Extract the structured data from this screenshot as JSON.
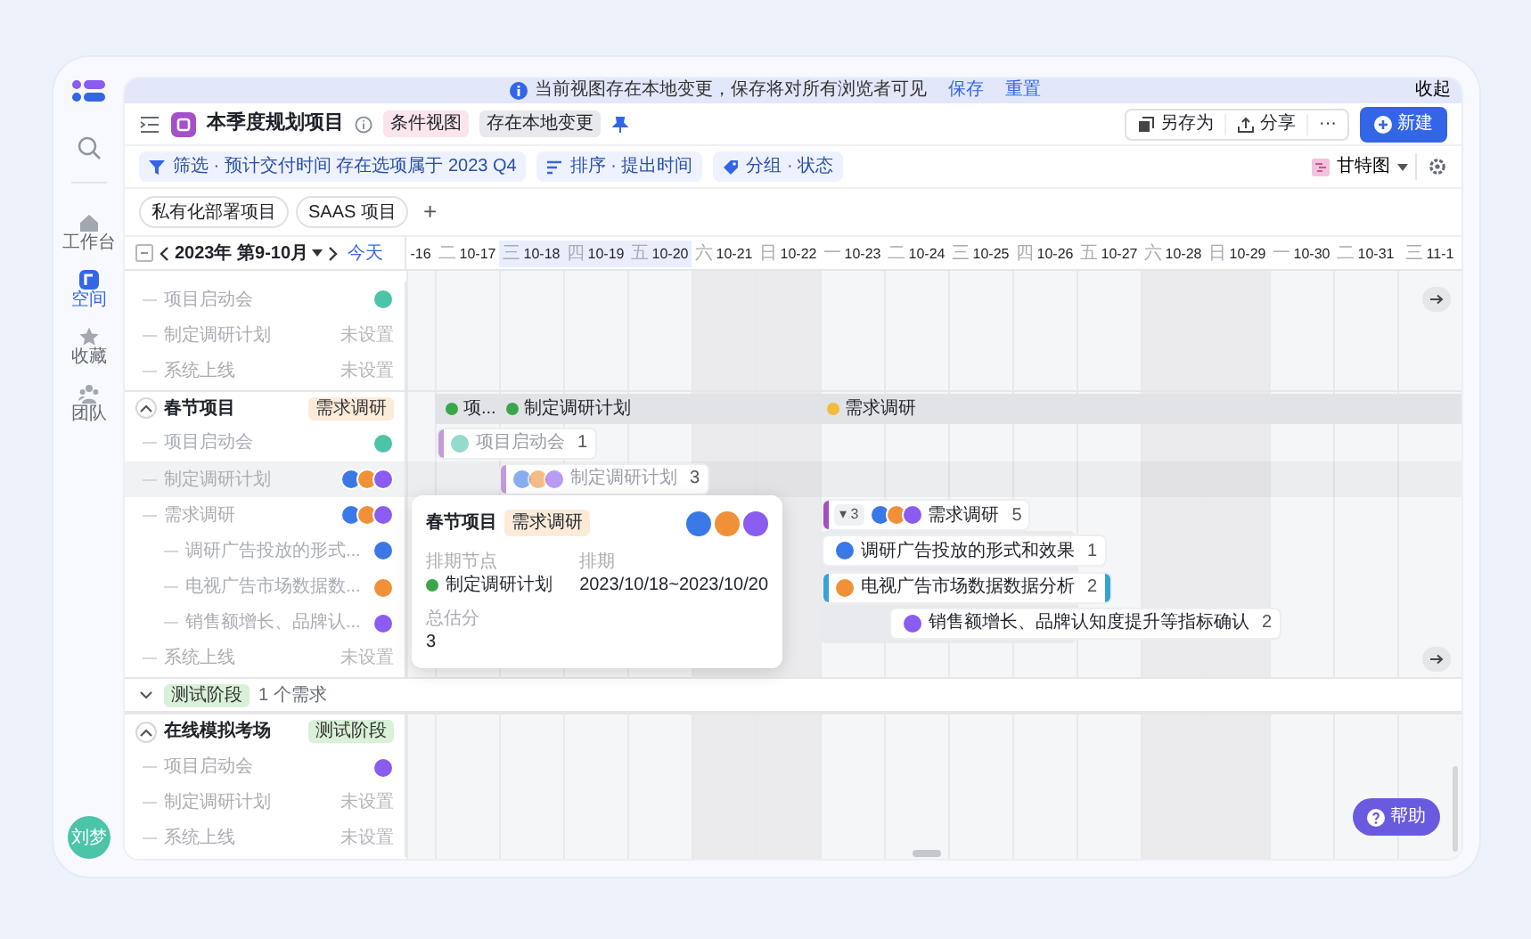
{
  "sidebar": {
    "items": [
      {
        "label": "工作台",
        "selected": false
      },
      {
        "label": "空间",
        "selected": true
      },
      {
        "label": "收藏",
        "selected": false
      },
      {
        "label": "团队",
        "selected": false
      }
    ],
    "user": "刘梦"
  },
  "notice": {
    "text": "当前视图存在本地变更，保存将对所有浏览者可见",
    "links": [
      "保存",
      "重置"
    ],
    "collapse": "收起"
  },
  "header": {
    "title": "本季度规划项目",
    "tags": [
      {
        "label": "条件视图",
        "color": "#fbe4ec"
      },
      {
        "label": "存在本地变更",
        "color": "#e8e9ec"
      }
    ],
    "actions": [
      "另存为",
      "分享",
      "···"
    ],
    "primary": "新建"
  },
  "filters": [
    "筛选 · 预计交付时间 存在选项属于 2023 Q4",
    "排序 · 提出时间",
    "分组 · 状态"
  ],
  "view": {
    "label": "甘特图"
  },
  "tabs": [
    "私有化部署项目",
    "SAAS 项目"
  ],
  "tab_add": "+",
  "gantt_nav": {
    "period": "2023年 第9-10月",
    "today": "今天"
  },
  "days": [
    {
      "date": "-16",
      "weekend": false,
      "highlighted": false
    },
    {
      "weekday": "二",
      "date": "10-17",
      "weekend": false,
      "highlighted": false
    },
    {
      "weekday": "三",
      "date": "10-18",
      "weekend": false,
      "highlighted": true
    },
    {
      "weekday": "四",
      "date": "10-19",
      "weekend": false,
      "highlighted": true
    },
    {
      "weekday": "五",
      "date": "10-20",
      "weekend": false,
      "highlighted": true
    },
    {
      "weekday": "六",
      "date": "10-21",
      "weekend": true,
      "highlighted": false
    },
    {
      "weekday": "日",
      "date": "10-22",
      "weekend": true,
      "highlighted": false
    },
    {
      "weekday": "一",
      "date": "10-23",
      "weekend": false,
      "highlighted": false
    },
    {
      "weekday": "二",
      "date": "10-24",
      "weekend": false,
      "highlighted": false
    },
    {
      "weekday": "三",
      "date": "10-25",
      "weekend": false,
      "highlighted": false
    },
    {
      "weekday": "四",
      "date": "10-26",
      "weekend": false,
      "highlighted": false
    },
    {
      "weekday": "五",
      "date": "10-27",
      "weekend": false,
      "highlighted": false
    },
    {
      "weekday": "六",
      "date": "10-28",
      "weekend": true,
      "highlighted": false
    },
    {
      "weekday": "日",
      "date": "10-29",
      "weekend": true,
      "highlighted": false
    },
    {
      "weekday": "一",
      "date": "10-30",
      "weekend": false,
      "highlighted": false
    },
    {
      "weekday": "二",
      "date": "10-31",
      "weekend": false,
      "highlighted": false
    },
    {
      "weekday": "三",
      "date": "11-1",
      "weekend": false,
      "highlighted": false
    }
  ],
  "rows": [
    {
      "kind": "task",
      "name": "项目启动会",
      "assignees": [
        {
          "color": "#4cc4a8"
        }
      ],
      "selected": false,
      "jump": true
    },
    {
      "kind": "task",
      "name": "制定调研计划",
      "schedule": "未设置",
      "selected": false,
      "jump": false
    },
    {
      "kind": "task",
      "name": "系统上线",
      "schedule": "未设置",
      "selected": false,
      "jump": false
    },
    {
      "kind": "project",
      "name": "春节项目",
      "tag": {
        "label": "需求调研",
        "color": "#fcebd9"
      },
      "expanded": true,
      "milestones": [
        {
          "label": "项...",
          "color": "#3aa64b"
        },
        {
          "label": "制定调研计划",
          "color": "#3aa64b"
        },
        {
          "label": "需求调研",
          "color": "#f2bb3b"
        }
      ],
      "children": [
        {
          "kind": "task",
          "name": "项目启动会",
          "assignees": [
            {
              "color": "#4cc4a8"
            }
          ],
          "selected": false,
          "jump": false,
          "bar": {
            "label": "项目启动会",
            "count": "1",
            "color": "#c59ad8",
            "faded": true
          }
        },
        {
          "kind": "task",
          "name": "制定调研计划",
          "assignees": [
            {
              "color": "#3b78e7"
            },
            {
              "color": "#f0913a"
            },
            {
              "color": "#8a5cf0"
            }
          ],
          "selected": true,
          "jump": false,
          "bar": {
            "label": "制定调研计划",
            "count": "3",
            "color": "#c59ad8",
            "faded": true
          }
        },
        {
          "kind": "task",
          "name": "需求调研",
          "assignees": [
            {
              "color": "#3b78e7"
            },
            {
              "color": "#f0913a"
            },
            {
              "color": "#8a5cf0"
            }
          ],
          "selected": false,
          "jump": false,
          "bar": {
            "label": "需求调研",
            "count": "5",
            "color": "#a24fc2",
            "faded": false,
            "collapse": "▾ 3"
          },
          "children": [
            {
              "kind": "task",
              "name": "调研广告投放的形式...",
              "assignees": [
                {
                  "color": "#3b78e7"
                }
              ],
              "selected": false,
              "jump": false,
              "bar": {
                "label": "调研广告投放的形式和效果",
                "count": "1",
                "faded": false,
                "selected": false
              }
            },
            {
              "kind": "task",
              "name": "电视广告市场数据数...",
              "assignees": [
                {
                  "color": "#f0913a"
                }
              ],
              "selected": false,
              "jump": false,
              "bar": {
                "label": "电视广告市场数据数据分析",
                "count": "2",
                "faded": false,
                "selected": true
              }
            },
            {
              "kind": "task",
              "name": "销售额增长、品牌认...",
              "assignees": [
                {
                  "color": "#8a5cf0"
                }
              ],
              "selected": false,
              "jump": false,
              "bar": {
                "label": "销售额增长、品牌认知度提升等指标确认",
                "count": "2",
                "faded": false,
                "selected": false
              }
            }
          ]
        },
        {
          "kind": "task",
          "name": "系统上线",
          "schedule": "未设置",
          "selected": false,
          "jump": true
        }
      ]
    },
    {
      "kind": "group",
      "tag": {
        "label": "测试阶段",
        "color": "#d9f0d9"
      },
      "count": "1 个需求",
      "expanded": true
    },
    {
      "kind": "project",
      "name": "在线模拟考场",
      "tag": {
        "label": "测试阶段",
        "color": "#d9f0d9"
      },
      "expanded": true,
      "children": [
        {
          "kind": "task",
          "name": "项目启动会",
          "assignees": [
            {
              "color": "#8a5cf0"
            }
          ],
          "selected": false,
          "jump": false
        },
        {
          "kind": "task",
          "name": "制定调研计划",
          "schedule": "未设置",
          "selected": false,
          "jump": false
        },
        {
          "kind": "task",
          "name": "系统上线",
          "schedule": "未设置",
          "selected": false,
          "jump": false
        }
      ]
    }
  ],
  "popover": {
    "title": "春节项目",
    "tag": {
      "label": "需求调研",
      "color": "#fcebd9"
    },
    "assignees": [
      {
        "color": "#3b78e7"
      },
      {
        "color": "#f0913a"
      },
      {
        "color": "#8a5cf0"
      }
    ],
    "fields": [
      {
        "label": "排期节点",
        "value": "制定调研计划",
        "color": "#3aa64b"
      },
      {
        "label": "排期",
        "value": "2023/10/18~2023/10/20"
      },
      {
        "label": "总估分",
        "value": "3"
      }
    ]
  },
  "help": "帮助"
}
